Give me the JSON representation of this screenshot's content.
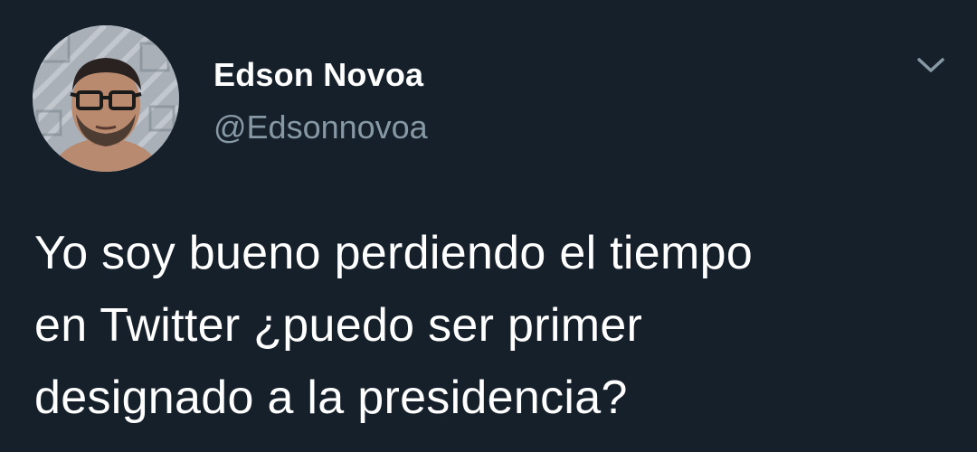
{
  "tweet": {
    "author": {
      "display_name": "Edson Novoa",
      "handle": "@Edsonnovoa",
      "avatar_icon": "avatar-photo"
    },
    "menu_icon": "chevron-down-icon",
    "text_lines": [
      "Yo soy bueno perdiendo el tiempo",
      "en Twitter ¿puedo ser primer",
      "designado a la presidencia?"
    ]
  },
  "colors": {
    "background": "#15202b",
    "primary_text": "#ffffff",
    "secondary_text": "#8899a6"
  }
}
